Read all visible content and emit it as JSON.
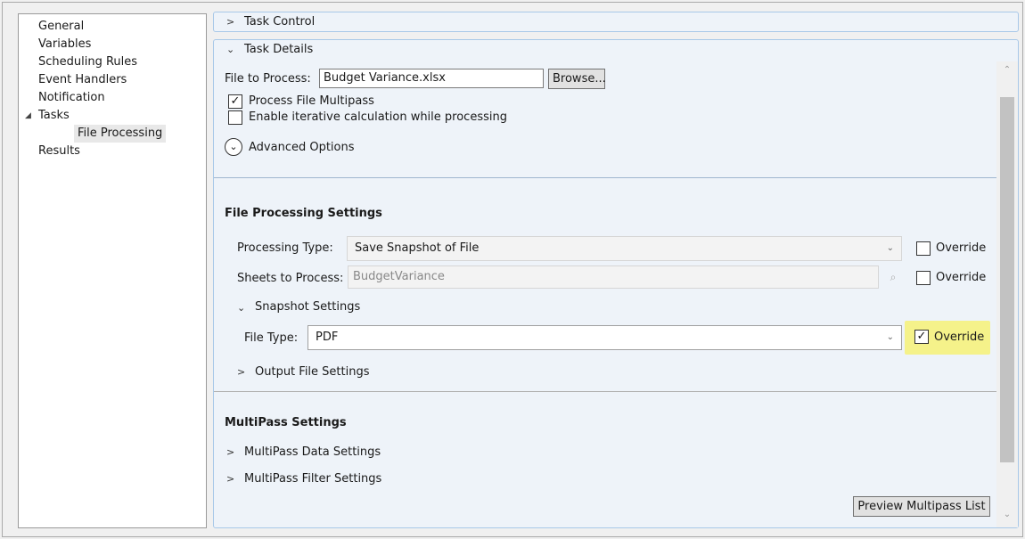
{
  "tree": {
    "items": [
      {
        "label": "General"
      },
      {
        "label": "Variables"
      },
      {
        "label": "Scheduling Rules"
      },
      {
        "label": "Event Handlers"
      },
      {
        "label": "Notification"
      },
      {
        "label": "Tasks"
      },
      {
        "label": "File Processing"
      },
      {
        "label": "Results"
      }
    ]
  },
  "task_control": {
    "label": "Task Control"
  },
  "task_details": {
    "label": "Task Details",
    "file_label": "File to Process:",
    "file_value": "Budget Variance.xlsx",
    "browse_label": "Browse...",
    "multipass_label": "Process File Multipass",
    "multipass_checked": true,
    "iterative_label": "Enable iterative calculation while processing",
    "iterative_checked": false,
    "advanced_label": "Advanced Options"
  },
  "file_processing": {
    "title": "File Processing Settings",
    "processing_type_label": "Processing Type:",
    "processing_type_value": "Save Snapshot of File",
    "sheets_label": "Sheets to Process:",
    "sheets_value": "BudgetVariance",
    "override_label": "Override",
    "snapshot_label": "Snapshot Settings",
    "file_type_label": "File Type:",
    "file_type_value": "PDF",
    "file_type_override_checked": true,
    "output_label": "Output File Settings"
  },
  "multipass": {
    "title": "MultiPass Settings",
    "data_label": "MultiPass Data Settings",
    "filter_label": "MultiPass Filter Settings",
    "preview_label": "Preview Multipass List"
  },
  "colors": {
    "highlight": "#f5f28a",
    "group_border": "#a8c8e8"
  }
}
